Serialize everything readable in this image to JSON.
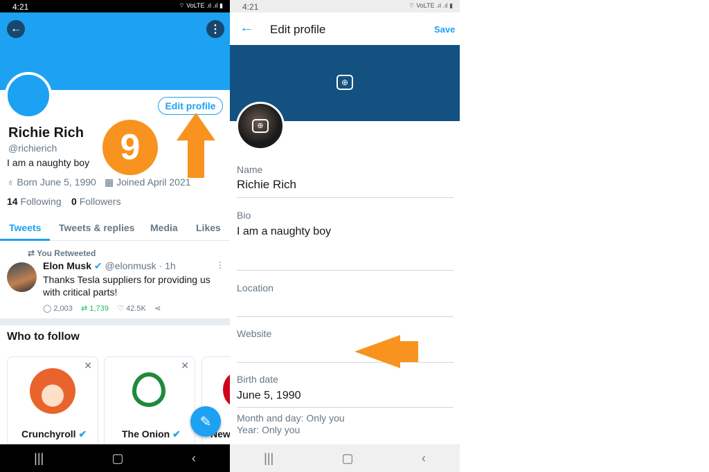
{
  "left": {
    "status_time": "4:21",
    "status_icons": "⌔ VoLTE .ıl .ıl ▮",
    "profile": {
      "name": "Richie Rich",
      "handle": "@richierich",
      "bio": "I am a naughty boy",
      "born": "Born June 5, 1990",
      "joined": "Joined April 2021",
      "following_count": "14",
      "following_label": "Following",
      "followers_count": "0",
      "followers_label": "Followers"
    },
    "edit_profile_label": "Edit profile",
    "tabs": [
      "Tweets",
      "Tweets & replies",
      "Media",
      "Likes"
    ],
    "tweet": {
      "retweet_label": "You Retweeted",
      "author": "Elon Musk",
      "handle": "@elonmusk · 1h",
      "text_line1": "Thanks Tesla suppliers for providing us",
      "text_line2": "with critical parts!",
      "replies": "2,003",
      "retweets": "1,739",
      "likes": "42.5K"
    },
    "who_to_follow": {
      "title": "Who to follow",
      "cards": [
        "Crunchyroll",
        "The Onion",
        "New"
      ]
    }
  },
  "right": {
    "status_time": "4:21",
    "title": "Edit profile",
    "save_label": "Save",
    "fields": {
      "name_label": "Name",
      "name_value": "Richie Rich",
      "bio_label": "Bio",
      "bio_value": "I am a naughty boy",
      "location_label": "Location",
      "website_label": "Website",
      "birth_label": "Birth date",
      "birth_value": "June 5, 1990",
      "month_privacy": "Month and day: Only you",
      "year_privacy": "Year: Only you"
    }
  },
  "annotation": {
    "step_number": "9",
    "color": "#f7931e"
  },
  "colors": {
    "brand_blue": "#1da1f2",
    "banner_dark": "#135180"
  }
}
